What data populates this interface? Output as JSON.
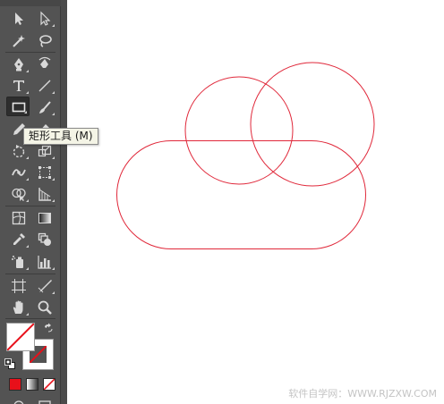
{
  "tooltip": {
    "text": "矩形工具 (M)"
  },
  "toolbar": {
    "tools": [
      {
        "name": "selection-tool-icon",
        "active": false
      },
      {
        "name": "direct-selection-tool-icon",
        "active": false
      },
      {
        "name": "magic-wand-tool-icon",
        "active": false
      },
      {
        "name": "lasso-tool-icon",
        "active": false
      },
      {
        "name": "pen-tool-icon",
        "active": false
      },
      {
        "name": "curvature-tool-icon",
        "active": false
      },
      {
        "name": "type-tool-icon",
        "active": false
      },
      {
        "name": "line-segment-tool-icon",
        "active": false
      },
      {
        "name": "rectangle-tool-icon",
        "active": true
      },
      {
        "name": "paintbrush-tool-icon",
        "active": false
      },
      {
        "name": "pencil-tool-icon",
        "active": false
      },
      {
        "name": "eraser-tool-icon",
        "active": false
      },
      {
        "name": "rotate-tool-icon",
        "active": false
      },
      {
        "name": "scale-tool-icon",
        "active": false
      },
      {
        "name": "width-tool-icon",
        "active": false
      },
      {
        "name": "free-transform-tool-icon",
        "active": false
      },
      {
        "name": "shape-builder-tool-icon",
        "active": false
      },
      {
        "name": "perspective-grid-tool-icon",
        "active": false
      },
      {
        "name": "mesh-tool-icon",
        "active": false
      },
      {
        "name": "gradient-tool-icon",
        "active": false
      },
      {
        "name": "eyedropper-tool-icon",
        "active": false
      },
      {
        "name": "blend-tool-icon",
        "active": false
      },
      {
        "name": "symbol-sprayer-tool-icon",
        "active": false
      },
      {
        "name": "column-graph-tool-icon",
        "active": false
      },
      {
        "name": "artboard-tool-icon",
        "active": false
      },
      {
        "name": "slice-tool-icon",
        "active": false
      },
      {
        "name": "hand-tool-icon",
        "active": false
      },
      {
        "name": "zoom-tool-icon",
        "active": false
      }
    ],
    "fill_color": "#ffffff",
    "stroke_color": "#ffffff",
    "none_slash_color": "#e8101a",
    "color_mode_color": "#e8101a"
  },
  "canvas": {
    "stroke_color": "#e0283a",
    "shapes": [
      "circle-left",
      "circle-right",
      "rounded-rectangle"
    ]
  },
  "watermark": {
    "text": "软件自学网：WWW.RJZXW.COM"
  }
}
